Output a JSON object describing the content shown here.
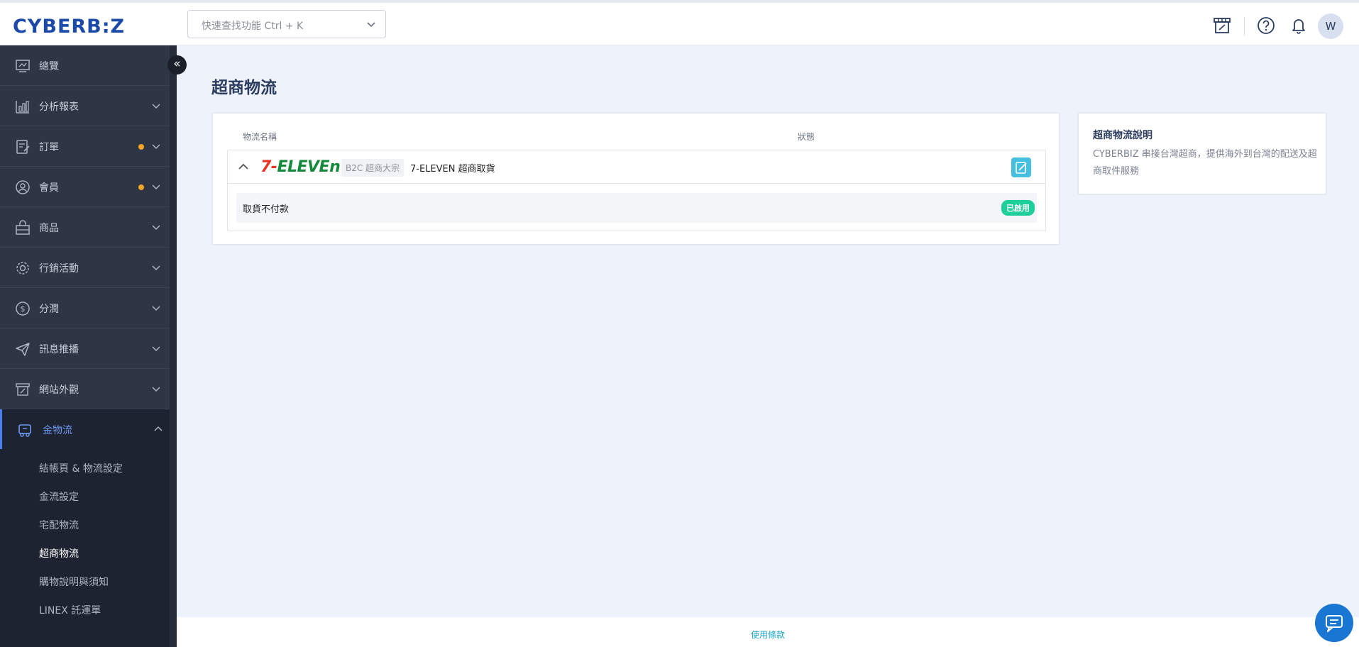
{
  "header": {
    "logo": "CYBERB:Z",
    "search_placeholder": "快速查找功能 Ctrl + K",
    "avatar_initial": "W"
  },
  "sidebar": {
    "items": [
      {
        "label": "總覽",
        "icon": "dashboard-icon",
        "has_arrow": false,
        "dot": false
      },
      {
        "label": "分析報表",
        "icon": "bar-chart-icon",
        "has_arrow": true,
        "dot": false
      },
      {
        "label": "訂單",
        "icon": "order-icon",
        "has_arrow": true,
        "dot": true
      },
      {
        "label": "會員",
        "icon": "user-icon",
        "has_arrow": true,
        "dot": true
      },
      {
        "label": "商品",
        "icon": "product-icon",
        "has_arrow": true,
        "dot": false
      },
      {
        "label": "行銷活動",
        "icon": "marketing-icon",
        "has_arrow": true,
        "dot": false
      },
      {
        "label": "分潤",
        "icon": "revenue-share-icon",
        "has_arrow": true,
        "dot": false
      },
      {
        "label": "訊息推播",
        "icon": "send-icon",
        "has_arrow": true,
        "dot": false
      },
      {
        "label": "網站外觀",
        "icon": "storefront-icon",
        "has_arrow": true,
        "dot": false
      },
      {
        "label": "金物流",
        "icon": "logistics-icon",
        "has_arrow": true,
        "dot": false,
        "active": true
      }
    ],
    "subitems": [
      {
        "label": "結帳頁 & 物流設定"
      },
      {
        "label": "金流設定"
      },
      {
        "label": "宅配物流"
      },
      {
        "label": "超商物流",
        "current": true
      },
      {
        "label": "購物說明與須知"
      },
      {
        "label": "LINEX 託運單"
      }
    ]
  },
  "main": {
    "title": "超商物流",
    "table": {
      "col_name": "物流名稱",
      "col_status": "狀態",
      "row": {
        "brand_logo_seven": "7-",
        "brand_logo_rest": "ELEVEn",
        "tag": "B2C 超商大宗",
        "name": "7-ELEVEN 超商取貨",
        "sub_label": "取貨不付款",
        "status": "已啟用"
      }
    },
    "info": {
      "title": "超商物流說明",
      "text": "CYBERBIZ 串接台灣超商，提供海外到台灣的配送及超商取件服務"
    }
  },
  "footer": {
    "terms_link": "使用條款"
  },
  "colors": {
    "sidebar_bg": "#2e3545",
    "accent": "#4a7ff0",
    "status_green": "#1fcf9b",
    "edit_btn": "#44bfe0"
  }
}
